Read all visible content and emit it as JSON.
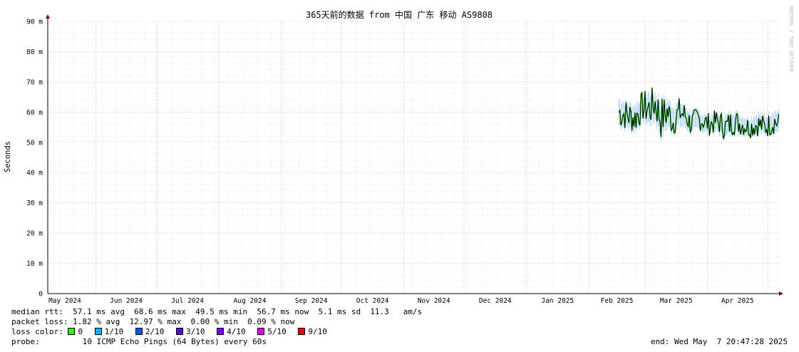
{
  "chart_data": {
    "type": "line",
    "title": "365天前的数据 from 中国 广东 移动 AS9808",
    "ylabel": "Seconds",
    "ylim": [
      0,
      0.09
    ],
    "y_ticks": [
      "0",
      "10 m",
      "20 m",
      "30 m",
      "40 m",
      "50 m",
      "60 m",
      "70 m",
      "80 m",
      "90 m"
    ],
    "x_ticks": [
      "May 2024",
      "Jun 2024",
      "Jul 2024",
      "Aug 2024",
      "Sep 2024",
      "Oct 2024",
      "Nov 2024",
      "Dec 2024",
      "Jan 2025",
      "Feb 2025",
      "Mar 2025",
      "Apr 2025"
    ],
    "x_range": [
      "2024-05-08",
      "2025-05-07"
    ],
    "grid": true,
    "series": [
      {
        "name": "median rtt",
        "x": [
          "2025-02-16",
          "2025-02-20",
          "2025-02-24",
          "2025-02-28",
          "2025-03-03",
          "2025-03-06",
          "2025-03-09",
          "2025-03-12",
          "2025-03-15",
          "2025-03-18",
          "2025-03-21",
          "2025-03-24",
          "2025-03-27",
          "2025-03-30",
          "2025-04-02",
          "2025-04-06",
          "2025-04-10",
          "2025-04-14",
          "2025-04-18",
          "2025-04-22",
          "2025-04-26",
          "2025-04-30",
          "2025-05-04",
          "2025-05-07"
        ],
        "y": [
          0.06,
          0.059,
          0.058,
          0.062,
          0.061,
          0.063,
          0.058,
          0.06,
          0.057,
          0.06,
          0.059,
          0.056,
          0.058,
          0.057,
          0.056,
          0.057,
          0.055,
          0.057,
          0.056,
          0.055,
          0.056,
          0.055,
          0.057,
          0.056
        ],
        "min": [
          0.054,
          0.053,
          0.052,
          0.055,
          0.054,
          0.055,
          0.0495,
          0.053,
          0.052,
          0.054,
          0.053,
          0.052,
          0.053,
          0.052,
          0.0515,
          0.052,
          0.05,
          0.052,
          0.0515,
          0.051,
          0.052,
          0.0515,
          0.052,
          0.0525
        ],
        "max": [
          0.066,
          0.065,
          0.064,
          0.067,
          0.0686,
          0.068,
          0.066,
          0.066,
          0.064,
          0.065,
          0.063,
          0.061,
          0.062,
          0.06,
          0.06,
          0.061,
          0.06,
          0.062,
          0.06,
          0.059,
          0.061,
          0.06,
          0.062,
          0.061
        ]
      }
    ]
  },
  "watermark": "RRDTOOL / TOBI OETIKER",
  "stats": {
    "rtt": "median rtt:  57.1 ms avg  68.6 ms max  49.5 ms min  56.7 ms now  5.1 ms sd  11.3   am/s",
    "loss": "packet loss: 1.82 % avg  12.97 % max  0.00 % min  0.09 % now",
    "loss_label": "loss color:",
    "legend": [
      {
        "label": "0",
        "color": "#26ff00"
      },
      {
        "label": "1/10",
        "color": "#00b8ff"
      },
      {
        "label": "2/10",
        "color": "#0059ff"
      },
      {
        "label": "3/10",
        "color": "#5e00ff"
      },
      {
        "label": "4/10",
        "color": "#7e00ff"
      },
      {
        "label": "5/10",
        "color": "#dd00ff"
      },
      {
        "label": "9/10",
        "color": "#ff0000"
      }
    ],
    "probe_label": "probe:",
    "probe": "10 ICMP Echo Pings (64 Bytes) every 60s",
    "end": "end: Wed May  7 20:47:28 2025"
  },
  "colors": {
    "grid_minor": "#dcdcdc",
    "grid_major": "#f0a0a0",
    "axis": "#000000",
    "arrow": "#800000",
    "line": "#000000",
    "range": "#5aa0ff",
    "loss0": "#26ff00"
  }
}
